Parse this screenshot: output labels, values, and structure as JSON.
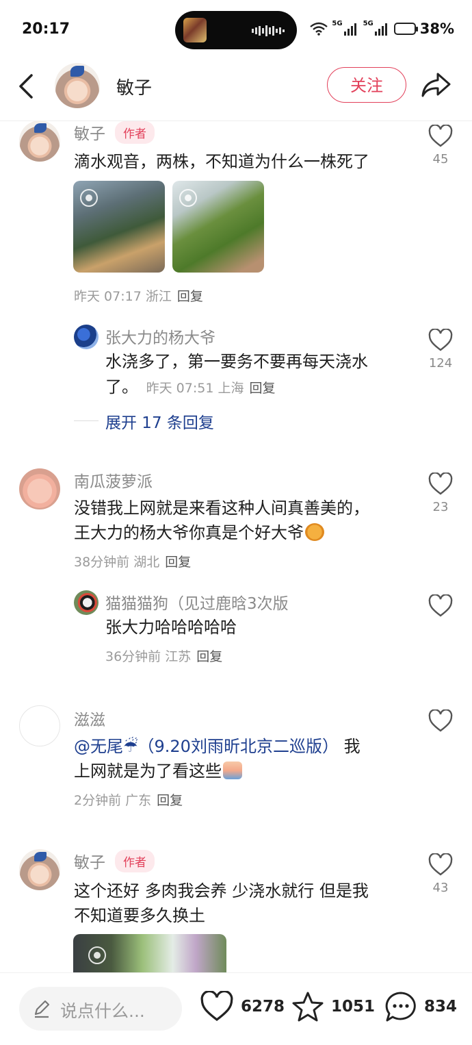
{
  "status": {
    "time": "20:17",
    "net1": "5G",
    "net2": "5G",
    "battery": "38%"
  },
  "header": {
    "author": "敏子",
    "follow_label": "关注"
  },
  "comments": [
    {
      "name": "敏子",
      "tag": "作者",
      "text": "滴水观音，两株，不知道为什么一株死了",
      "time": "昨天 07:17",
      "loc": "浙江",
      "reply": "回复",
      "likes": "45",
      "replies": [
        {
          "name": "张大力的杨大爷",
          "line1": "水浇多了，第一要务不要再每天浇水",
          "line2": "了。",
          "time": "昨天 07:51",
          "loc": "上海",
          "reply": "回复",
          "likes": "124"
        }
      ],
      "expand": "展开 17 条回复"
    },
    {
      "name": "南瓜菠萝派",
      "line1": "没错我上网就是来看这种人间真善美的，",
      "line2": "王大力的杨大爷你真是个好大爷",
      "time": "38分钟前",
      "loc": "湖北",
      "reply": "回复",
      "likes": "23",
      "replies": [
        {
          "name": "猫猫猫狗（见过鹿晗3次版",
          "text": "张大力哈哈哈哈哈",
          "time": "36分钟前",
          "loc": "江苏",
          "reply": "回复"
        }
      ]
    },
    {
      "name": "滋滋",
      "mention": "@无尾☔（9.20刘雨昕北京二巡版）",
      "line1_rest": " 我",
      "line2": "上网就是为了看这些",
      "time": "2分钟前",
      "loc": "广东",
      "reply": "回复"
    },
    {
      "name": "敏子",
      "tag": "作者",
      "line1": "这个还好 多肉我会养 少浇水就行 但是我",
      "line2": "不知道要多久换土",
      "likes": "43"
    }
  ],
  "bottom": {
    "placeholder": "说点什么...",
    "likes": "6278",
    "stars": "1051",
    "comments": "834"
  }
}
